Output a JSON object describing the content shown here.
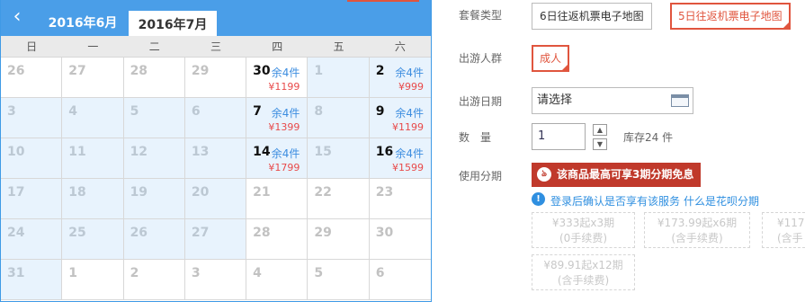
{
  "calendar": {
    "prev_icon": "chevron-left-icon",
    "tabs": [
      "2016年6月",
      "2016年7月"
    ],
    "weekdays": [
      "日",
      "一",
      "二",
      "三",
      "四",
      "五",
      "六"
    ],
    "cells": [
      {
        "day": "26",
        "cur": false
      },
      {
        "day": "27",
        "cur": false
      },
      {
        "day": "28",
        "cur": false
      },
      {
        "day": "29",
        "cur": false
      },
      {
        "day": "30",
        "cur": false,
        "stock": "余4件",
        "price": "¥1199"
      },
      {
        "day": "1",
        "cur": true
      },
      {
        "day": "2",
        "cur": true,
        "stock": "余4件",
        "price": "¥999"
      },
      {
        "day": "3",
        "cur": true
      },
      {
        "day": "4",
        "cur": true
      },
      {
        "day": "5",
        "cur": true
      },
      {
        "day": "6",
        "cur": true
      },
      {
        "day": "7",
        "cur": true,
        "stock": "余4件",
        "price": "¥1399"
      },
      {
        "day": "8",
        "cur": true
      },
      {
        "day": "9",
        "cur": true,
        "stock": "余4件",
        "price": "¥1199"
      },
      {
        "day": "10",
        "cur": true
      },
      {
        "day": "11",
        "cur": true
      },
      {
        "day": "12",
        "cur": true
      },
      {
        "day": "13",
        "cur": true
      },
      {
        "day": "14",
        "cur": true,
        "stock": "余4件",
        "price": "¥1799"
      },
      {
        "day": "15",
        "cur": true
      },
      {
        "day": "16",
        "cur": true,
        "stock": "余4件",
        "price": "¥1599"
      },
      {
        "day": "17",
        "cur": true
      },
      {
        "day": "18",
        "cur": true
      },
      {
        "day": "19",
        "cur": true
      },
      {
        "day": "20",
        "cur": true
      },
      {
        "day": "21",
        "cur": false
      },
      {
        "day": "22",
        "cur": false
      },
      {
        "day": "23",
        "cur": false
      },
      {
        "day": "24",
        "cur": true
      },
      {
        "day": "25",
        "cur": true
      },
      {
        "day": "26",
        "cur": true
      },
      {
        "day": "27",
        "cur": true
      },
      {
        "day": "28",
        "cur": false
      },
      {
        "day": "29",
        "cur": false
      },
      {
        "day": "30",
        "cur": false
      },
      {
        "day": "31",
        "cur": true
      },
      {
        "day": "1",
        "cur": false
      },
      {
        "day": "2",
        "cur": false
      },
      {
        "day": "3",
        "cur": false
      },
      {
        "day": "4",
        "cur": false
      },
      {
        "day": "5",
        "cur": false
      },
      {
        "day": "6",
        "cur": false
      }
    ]
  },
  "form": {
    "package_label": "套餐类型",
    "package_options": [
      "6日往返机票电子地图",
      "5日往返机票电子地图"
    ],
    "traveler_label": "出游人群",
    "traveler_option": "成人",
    "date_label": "出游日期",
    "date_value": "请选择",
    "qty_label": "数　量",
    "qty_value": "1",
    "stock_text": "库存24 件",
    "installment_label": "使用分期",
    "promo_text": "该商品最高可享3期分期免息",
    "info_text": "登录后确认是否享有该服务",
    "info_link": "什么是花呗分期",
    "plans": [
      {
        "line1": "¥333起x3期",
        "line2": "(0手续费)"
      },
      {
        "line1": "¥173.99起x6期",
        "line2": "(含手续费)"
      },
      {
        "line1": "¥117.",
        "line2": "(含手"
      },
      {
        "line1": "¥89.91起x12期",
        "line2": "(含手续费)"
      }
    ]
  },
  "colors": {
    "calendar_header": "#4a9ee8",
    "selected_border": "#e0553e",
    "promo_bg": "#c0392b",
    "link_blue": "#2f8fe0",
    "price_red": "#e84a4a"
  }
}
